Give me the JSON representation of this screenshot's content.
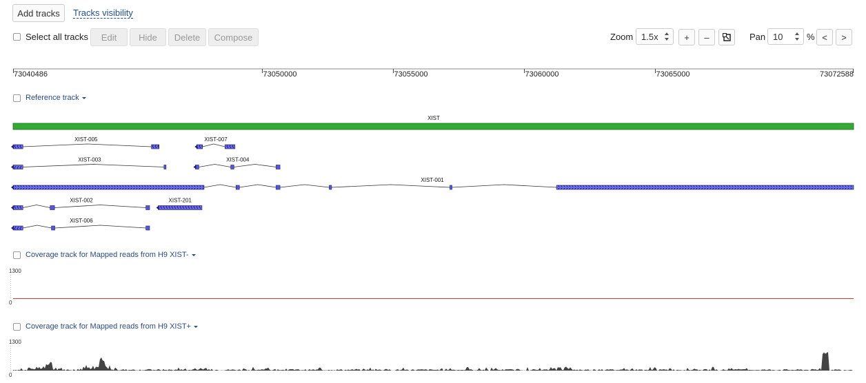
{
  "toolbar": {
    "add_tracks": "Add tracks",
    "tracks_visibility": "Tracks visibility",
    "select_all": "Select all tracks",
    "edit": "Edit",
    "hide": "Hide",
    "delete": "Delete",
    "compose": "Compose",
    "zoom_label": "Zoom",
    "zoom_value": "1.5x",
    "zoom_in": "+",
    "zoom_out": "–",
    "zoom_reset_icon": "reset-view-icon",
    "pan_label": "Pan",
    "pan_value": "10",
    "pan_unit": "%",
    "pan_left": "<",
    "pan_right": ">"
  },
  "ruler": {
    "start": 73040486,
    "end": 73072588,
    "start_label": "73040486",
    "end_label": "73072588",
    "ticks": [
      {
        "pos": 73050000,
        "label": "73050000"
      },
      {
        "pos": 73055000,
        "label": "73055000"
      },
      {
        "pos": 73060000,
        "label": "73060000"
      },
      {
        "pos": 73065000,
        "label": "73065000"
      }
    ]
  },
  "reference_track": {
    "title": "Reference track",
    "gene": {
      "name": "XIST",
      "color": "#33aa33",
      "start": 73040486,
      "end": 73072588
    },
    "transcript_color": "#5555dd",
    "transcripts": [
      {
        "name": "XIST-005",
        "row": 0,
        "exons": [
          [
            73040486,
            73040860
          ],
          [
            73045770,
            73046060
          ]
        ]
      },
      {
        "name": "XIST-007",
        "row": 0,
        "exons": [
          [
            73047500,
            73047720
          ],
          [
            73048580,
            73048960
          ]
        ]
      },
      {
        "name": "XIST-003",
        "row": 1,
        "exons": [
          [
            73040486,
            73040860
          ],
          [
            73046250,
            73046310
          ]
        ]
      },
      {
        "name": "XIST-004",
        "row": 1,
        "exons": [
          [
            73047450,
            73047580
          ],
          [
            73048800,
            73048920
          ],
          [
            73050530,
            73050680
          ]
        ]
      },
      {
        "name": "XIST-001",
        "row": 2,
        "label_pos": 73056500,
        "exons": [
          [
            73040486,
            73047780
          ],
          [
            73049000,
            73049130
          ],
          [
            73050530,
            73050680
          ],
          [
            73052560,
            73052650
          ],
          [
            73057170,
            73057240
          ],
          [
            73061240,
            73072588
          ]
        ]
      },
      {
        "name": "XIST-002",
        "row": 3,
        "exons": [
          [
            73040486,
            73040860
          ],
          [
            73041900,
            73042070
          ],
          [
            73045560,
            73045700
          ]
        ]
      },
      {
        "name": "XIST-201",
        "row": 3,
        "exons": [
          [
            73046030,
            73047700
          ]
        ]
      },
      {
        "name": "XIST-006",
        "row": 4,
        "exons": [
          [
            73040486,
            73040860
          ],
          [
            73041950,
            73042080
          ],
          [
            73045560,
            73045700
          ]
        ]
      }
    ]
  },
  "coverage_tracks": [
    {
      "title": "Coverage track for Mapped reads from H9 XIST-",
      "max_label": "1300",
      "min_label": "0",
      "color": "#dd3333"
    },
    {
      "title": "Coverage track for Mapped reads from H9 XIST+",
      "max_label": "1300",
      "min_label": "0",
      "color": "#444444"
    }
  ]
}
